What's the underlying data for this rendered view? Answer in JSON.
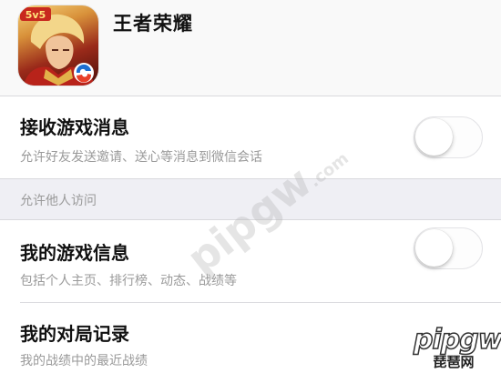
{
  "app": {
    "title": "王者荣耀",
    "icon": {
      "name": "honor-of-kings-app-icon",
      "badge_text": "5v5",
      "accent": "#c8281e"
    }
  },
  "settings": [
    {
      "title": "接收游戏消息",
      "subtitle": "允许好友发送邀请、送心等消息到微信会话",
      "toggle_on": false
    }
  ],
  "section": {
    "label": "允许他人访问"
  },
  "access_items": [
    {
      "title": "我的游戏信息",
      "subtitle": "包括个人主页、排行榜、动态、战绩等",
      "toggle_on": false
    },
    {
      "title": "我的对局记录",
      "subtitle": "我的战绩中的最近战绩"
    }
  ],
  "watermark": {
    "text": "pipgw",
    "sub": ".com",
    "site_name": "琵琶网"
  },
  "colors": {
    "background": "#efeff4",
    "row": "#ffffff",
    "text_primary": "#111111",
    "text_secondary": "#9a9a9a",
    "toggle_off": "#e3e3e6"
  }
}
